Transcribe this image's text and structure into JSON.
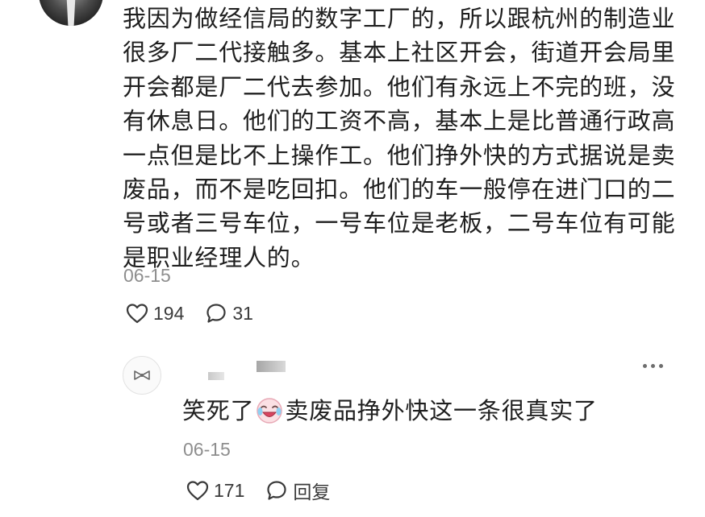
{
  "post": {
    "text": "我因为做经信局的数字工厂的，所以跟杭州的制造业很多厂二代接触多。基本上社区开会，街道开会局里开会都是厂二代去参加。他们有永远上不完的班，没有休息日。他们的工资不高，基本上是比普通行政高一点但是比不上操作工。他们挣外快的方式据说是卖废品，而不是吃回扣。他们的车一般停在进门口的二号或者三号车位，一号车位是老板，二号车位有可能是职业经理人的。",
    "date": "06-15",
    "likes": "194",
    "comments": "31"
  },
  "reply": {
    "text_before_emoji": "笑死了",
    "emoji": "crying-laughing-face",
    "text_after_emoji": "卖废品挣外快这一条很真实了",
    "date": "06-15",
    "likes": "171",
    "reply_label": "回复"
  },
  "icons": {
    "like": "heart-outline-icon",
    "comment": "speech-bubble-icon",
    "more": "three-dots-icon"
  },
  "colors": {
    "text": "#1f1f1f",
    "meta": "#8e8e8e",
    "icon": "#3a3a3a"
  }
}
